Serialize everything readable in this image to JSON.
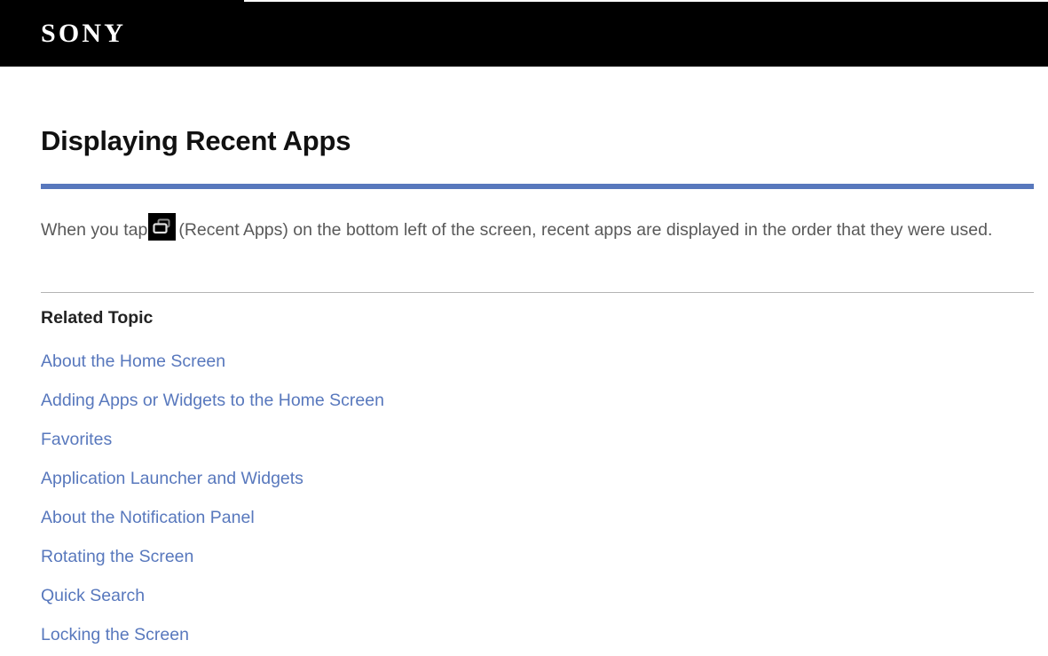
{
  "header": {
    "logo_text": "SONY",
    "logo_name": "sony-logo"
  },
  "main": {
    "title": "Displaying Recent Apps",
    "intro_before_icon": "When you tap",
    "intro_icon_name": "recent-apps-icon",
    "intro_after_icon": "(Recent Apps) on the bottom left of the screen, recent apps are displayed in the order that they were used.",
    "related": {
      "heading": "Related Topic",
      "links": [
        "About the Home Screen",
        "Adding Apps or Widgets to the Home Screen",
        "Favorites",
        "Application Launcher and Widgets",
        "About the Notification Panel",
        "Rotating the Screen",
        "Quick Search",
        "Locking the Screen"
      ]
    }
  },
  "colors": {
    "header_background": "#000000",
    "accent_rule": "#5878bd",
    "link": "#5878bd",
    "body_text": "#595959",
    "divider": "#b4b4b4"
  }
}
